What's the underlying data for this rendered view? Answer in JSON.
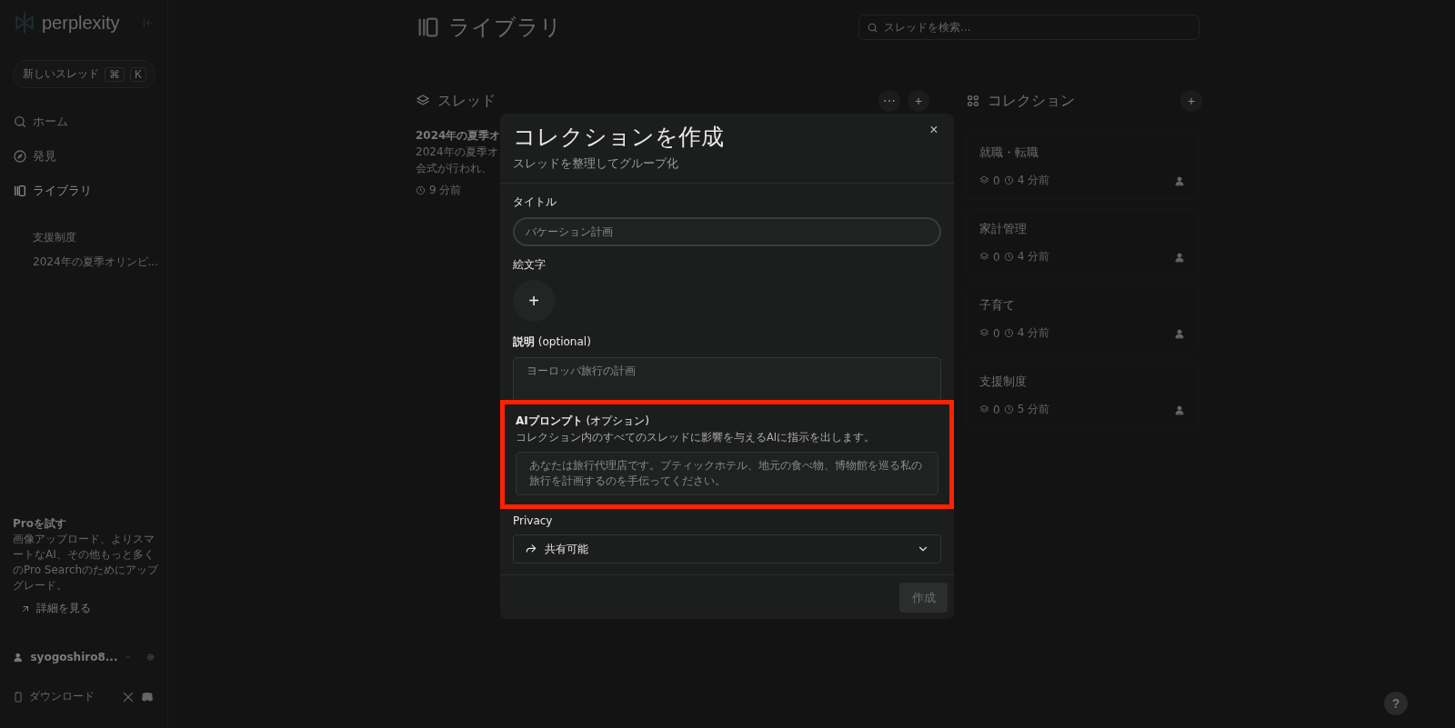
{
  "sidebar": {
    "logo": "perplexity",
    "new_thread": {
      "label": "新しいスレッド",
      "keys": [
        "⌘",
        "K"
      ]
    },
    "nav": [
      {
        "label": "ホーム",
        "selected": false
      },
      {
        "label": "発見",
        "selected": false
      },
      {
        "label": "ライブラリ",
        "selected": true
      }
    ],
    "library_items": [
      "支援制度",
      "2024年の夏季オリンピ..."
    ],
    "pro": {
      "title": "Proを試す",
      "text": "画像アップロード、よりスマートなAI、その他もっと多くのPro Searchのためにアップグレード。",
      "link": "詳細を見る"
    },
    "user": {
      "name": "syogoshiro8..."
    },
    "download": "ダウンロード"
  },
  "page": {
    "title": "ライブラリ",
    "search": {
      "placeholder": "スレッドを検索..."
    },
    "threads": {
      "heading": "スレッド",
      "more": "⋯",
      "add": "+",
      "items": [
        {
          "title": "2024年の夏季オ",
          "lines": [
            "2024年の夏季オ",
            "会式が行われ、"
          ],
          "time": "9 分前"
        }
      ]
    },
    "collections": {
      "heading": "コレクション",
      "add": "+",
      "items": [
        {
          "title": "就職・転職",
          "count": "0",
          "time": "4 分前"
        },
        {
          "title": "家計管理",
          "count": "0",
          "time": "4 分前"
        },
        {
          "title": "子育て",
          "count": "0",
          "time": "4 分前"
        },
        {
          "title": "支援制度",
          "count": "0",
          "time": "5 分前"
        }
      ]
    }
  },
  "modal": {
    "title": "コレクションを作成",
    "close": "×",
    "subtitle": "スレッドを整理してグループ化",
    "title_field": {
      "label": "タイトル",
      "placeholder": "バケーション計画"
    },
    "emoji": {
      "label": "絵文字",
      "button": "+"
    },
    "description": {
      "label": "**説明** (optional)",
      "placeholder": "ヨーロッパ旅行の計画"
    },
    "ai_prompt": {
      "label": "**AIプロンプト** (オプション)",
      "hint": "コレクション内のすべてのスレッドに影響を与えるAIに指示を出します。",
      "placeholder": "あなたは旅行代理店です。ブティックホテル、地元の食べ物、博物館を巡る私の旅行を計画するのを手伝ってください。",
      "highlighted": true
    },
    "privacy": {
      "label": "Privacy",
      "value": "共有可能"
    },
    "submit": {
      "label": "作成",
      "disabled": true
    }
  },
  "help": "?"
}
